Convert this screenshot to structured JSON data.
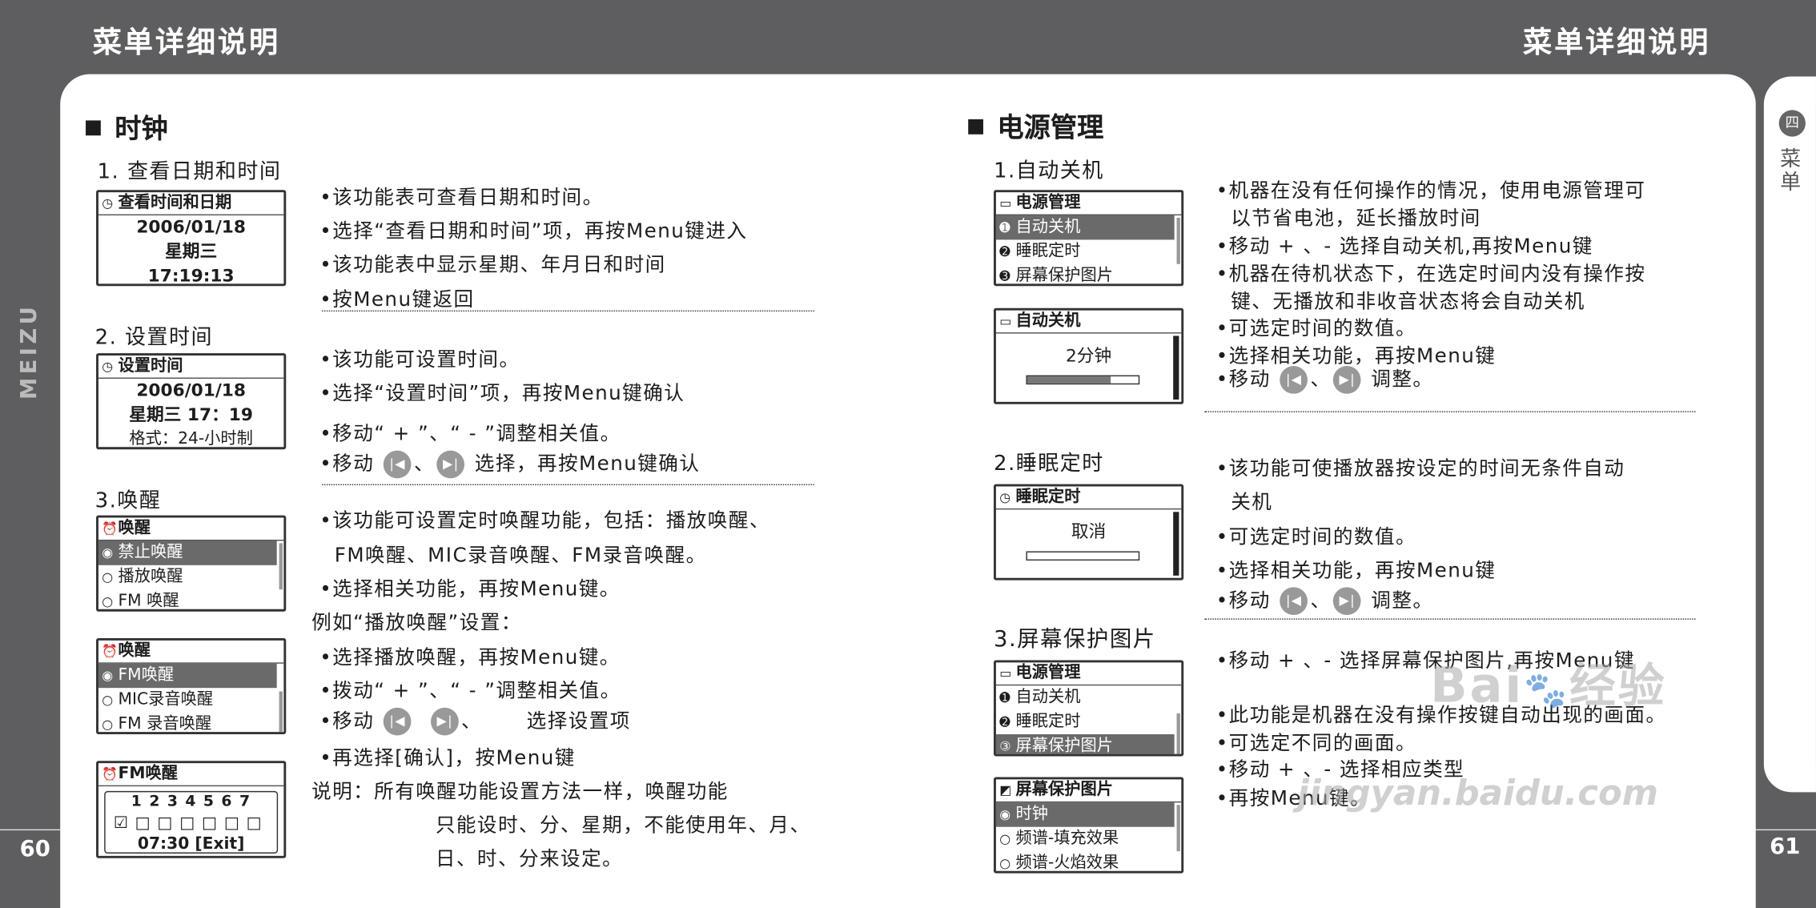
{
  "header": {
    "left": "菜单详细说明",
    "right": "菜单详细说明"
  },
  "page_numbers": {
    "left": "60",
    "right": "61"
  },
  "brand_logo": "MEIZU",
  "tab": {
    "icon": "四",
    "label": "菜单"
  },
  "left": {
    "title": "时钟",
    "s1": {
      "head": "1. 查看日期和时间",
      "lcd": {
        "title": "查看时间和日期",
        "date": "2006/01/18",
        "weekday": "星期三",
        "time": "17:19:13"
      },
      "lines": [
        "•该功能表可查看日期和时间。",
        "•选择“查看日期和时间”项，再按Menu键进入",
        "•该功能表中显示星期、年月日和时间",
        "•按Menu键返回"
      ]
    },
    "s2": {
      "head": "2. 设置时间",
      "lcd": {
        "title": "设置时间",
        "date": "2006/01/18",
        "weekday_time": "星期三 17：19",
        "format": "格式：24-小时制"
      },
      "lines": [
        "•该功能可设置时间。",
        "•选择“设置时间”项，再按Menu键确认",
        "•移动“ + ”、“  - ”调整相关值。"
      ],
      "l4a": "•移动",
      "l4sep": "、",
      "l4b": "选择，再按Menu键确认"
    },
    "s3": {
      "head": "3.唤醒",
      "lcd1": {
        "title": "唤醒",
        "items": [
          "禁止唤醒",
          "播放唤醒",
          "FM 唤醒"
        ]
      },
      "lcd2": {
        "title": "唤醒",
        "items": [
          "FM唤醒",
          "MIC录音唤醒",
          "FM 录音唤醒"
        ]
      },
      "lcd3": {
        "title": "FM唤醒",
        "days": "1 2 3 4 5 6 7",
        "time": "07:30 [Exit]"
      },
      "lines": [
        "•该功能可设置定时唤醒功能，包括：播放唤醒、",
        "  FM唤醒、MIC录音唤醒、FM录音唤醒。",
        "•选择相关功能，再按Menu键。",
        "例如“播放唤醒”设置：",
        "•选择播放唤醒，再按Menu键。",
        "•拨动“ + ”、“  - ”调整相关值。"
      ],
      "l7a": "•移动",
      "l7b": "、",
      "l7c": "选择设置项",
      "l8": "•再选择[确认]，按Menu键",
      "note": [
        "说明：所有唤醒功能设置方法一样，唤醒功能",
        "只能设时、分、星期，不能使用年、月、",
        "日、时、分来设定。"
      ]
    }
  },
  "right": {
    "title": "电源管理",
    "s1": {
      "head": "1.自动关机",
      "lcd1": {
        "title": "电源管理",
        "items": [
          "自动关机",
          "睡眠定时",
          "屏幕保护图片"
        ]
      },
      "lcd2": {
        "title": "自动关机",
        "value": "2分钟",
        "progress": 0.75
      },
      "lines": [
        "•机器在没有任何操作的情况，使用电源管理可",
        "  以节省电池，延长播放时间",
        "•移动 + 、- 选择自动关机,再按Menu键",
        "•机器在待机状态下，在选定时间内没有操作按",
        "  键、无播放和非收音状态将会自动关机",
        "•可选定时间的数值。",
        "•选择相关功能，再按Menu键"
      ],
      "l8a": "•移动",
      "l8b": "、",
      "l8c": "调整。"
    },
    "s2": {
      "head": "2.睡眠定时",
      "lcd": {
        "title": "睡眠定时",
        "value": "取消",
        "progress": 0
      },
      "lines": [
        "•该功能可使播放器按设定的时间无条件自动",
        "  关机",
        "•可选定时间的数值。",
        "•选择相关功能，再按Menu键"
      ],
      "l5a": "•移动",
      "l5b": "、",
      "l5c": "调整。"
    },
    "s3": {
      "head": "3.屏幕保护图片",
      "lcd1": {
        "title": "电源管理",
        "items": [
          "自动关机",
          "睡眠定时",
          "屏幕保护图片"
        ]
      },
      "lcd2": {
        "title": "屏幕保护图片",
        "items": [
          "时钟",
          "频谱-填充效果",
          "频谱-火焰效果"
        ]
      },
      "lines": [
        "•移动 + 、- 选择屏幕保护图片,再按Menu键",
        "•此功能是机器在没有操作按键自动出现的画面。",
        "•可选定不同的画面。",
        "•移动 + 、- 选择相应类型",
        "•再按Menu键。"
      ]
    }
  },
  "watermark": {
    "brand": "Bai",
    "brand2": "经验",
    "url": "jingyan.baidu.com"
  }
}
